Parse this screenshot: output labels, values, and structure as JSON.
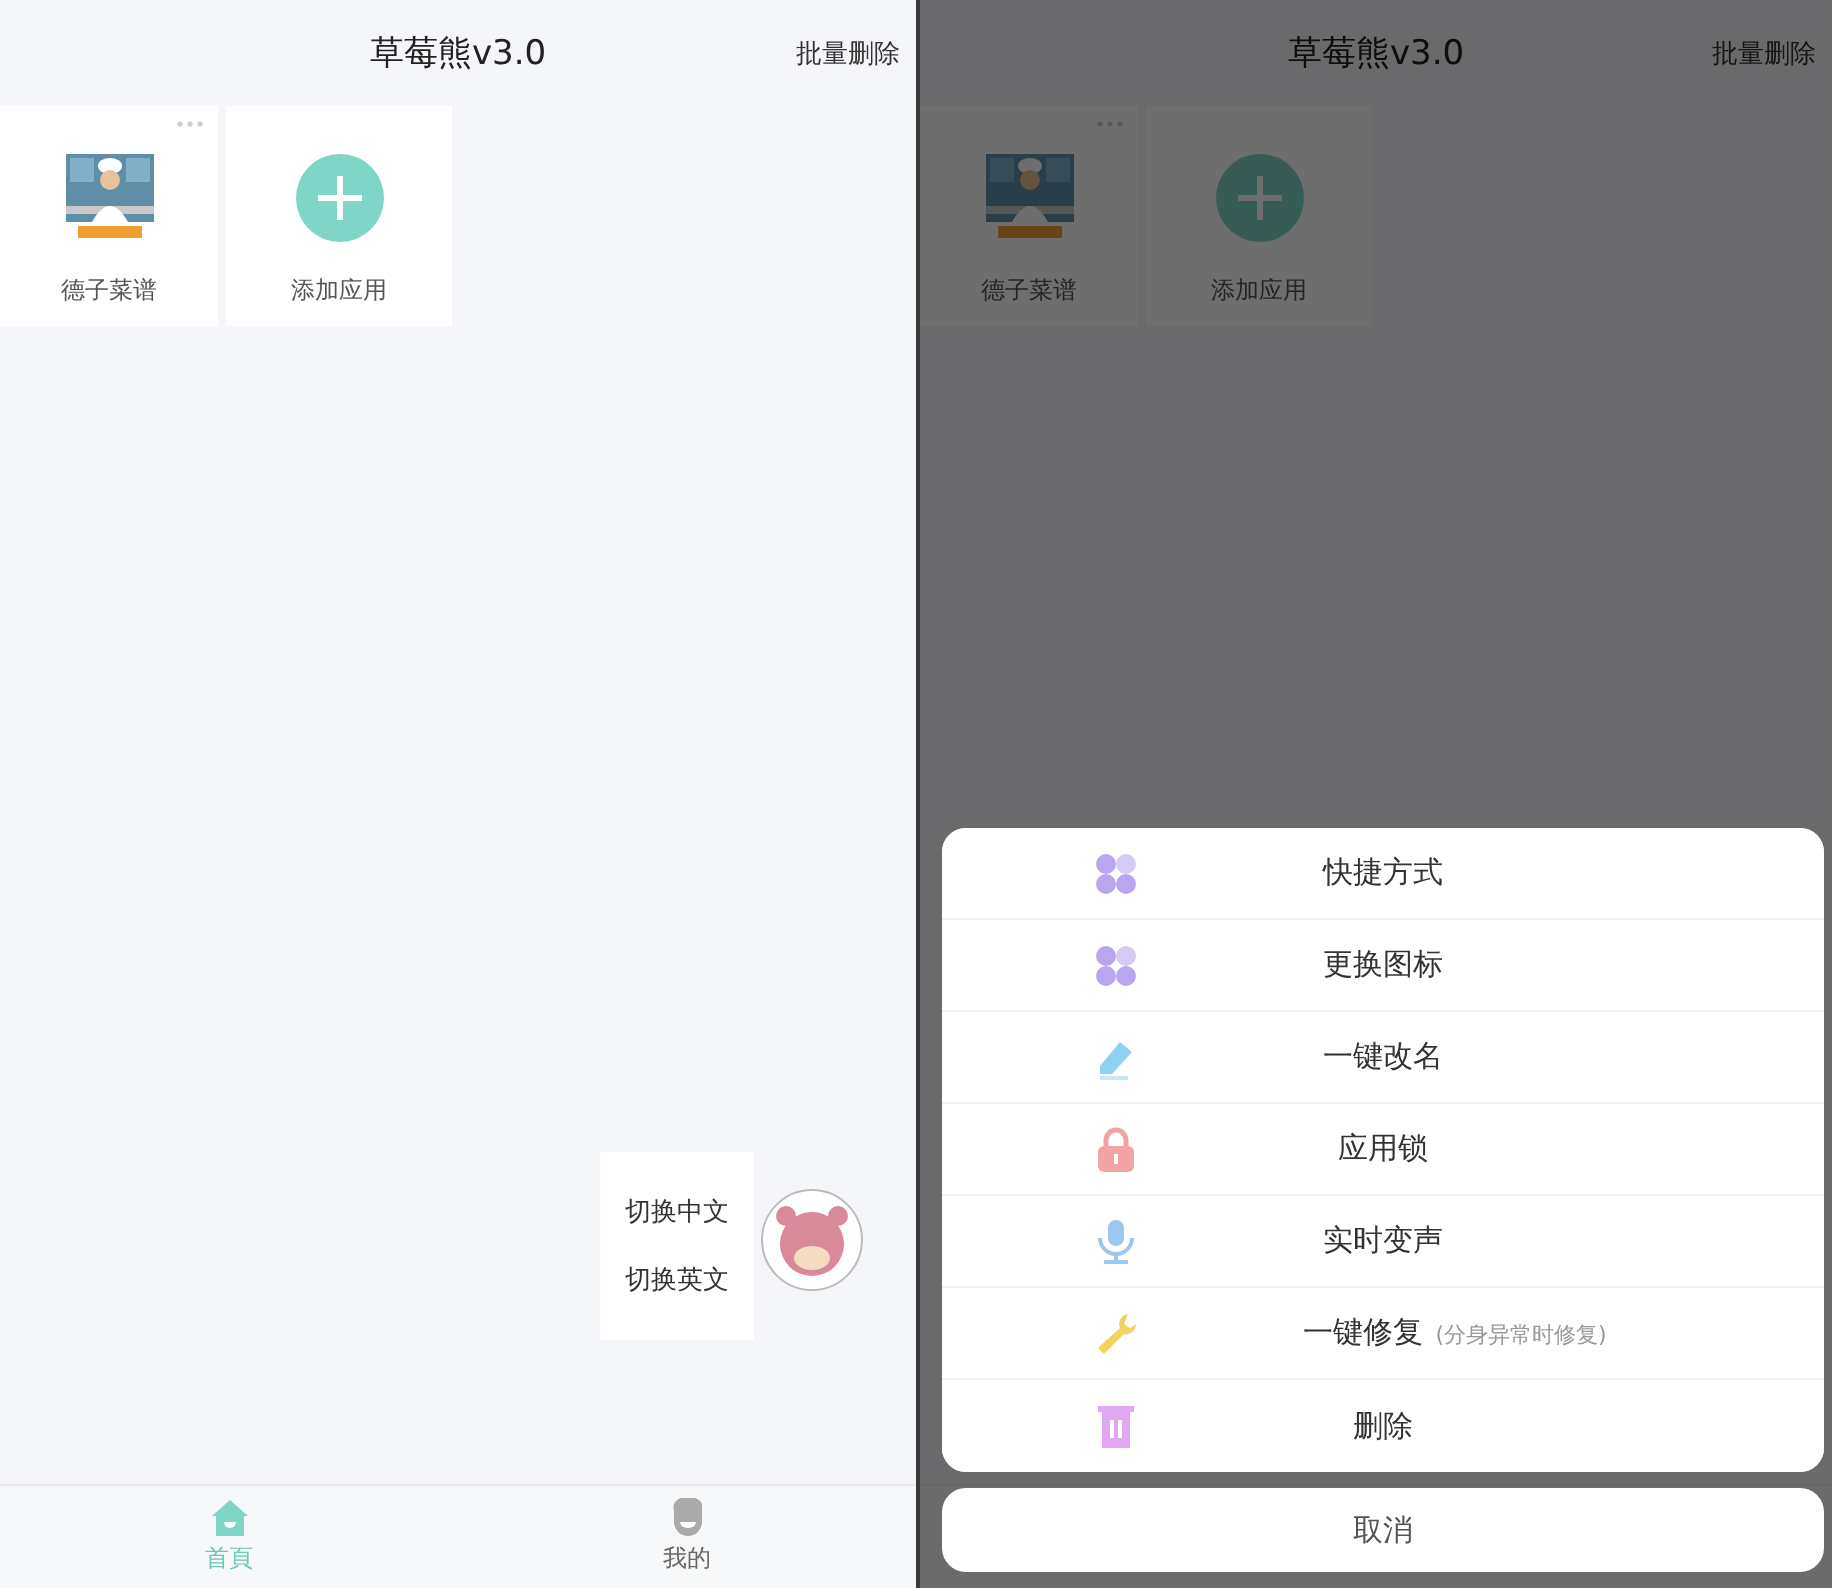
{
  "left_screen": {
    "header": {
      "title": "草莓熊v3.0",
      "action": "批量删除"
    },
    "apps": [
      {
        "kind": "app",
        "label": "德子菜谱"
      },
      {
        "kind": "add",
        "label": "添加应用"
      }
    ],
    "language_menu": {
      "options": [
        "切换中文",
        "切换英文"
      ]
    },
    "tab_bar": [
      {
        "label": "首頁",
        "kind": "home",
        "selected": true
      },
      {
        "label": "我的",
        "kind": "profile",
        "selected": false
      }
    ]
  },
  "right_screen": {
    "header": {
      "title": "草莓熊v3.0",
      "action": "批量删除"
    },
    "apps": [
      {
        "kind": "app",
        "label": "德子菜谱"
      },
      {
        "kind": "add",
        "label": "添加应用"
      }
    ],
    "action_sheet": {
      "items": [
        {
          "kind": "clover",
          "label": "快捷方式"
        },
        {
          "kind": "clover",
          "label": "更换图标"
        },
        {
          "kind": "pencil",
          "label": "一键改名"
        },
        {
          "kind": "lock",
          "label": "应用锁"
        },
        {
          "kind": "mic",
          "label": "实时变声"
        },
        {
          "kind": "wrench",
          "label": "一键修复",
          "note": "(分身异常时修复)"
        },
        {
          "kind": "trash",
          "label": "删除"
        }
      ],
      "cancel": "取消"
    }
  }
}
